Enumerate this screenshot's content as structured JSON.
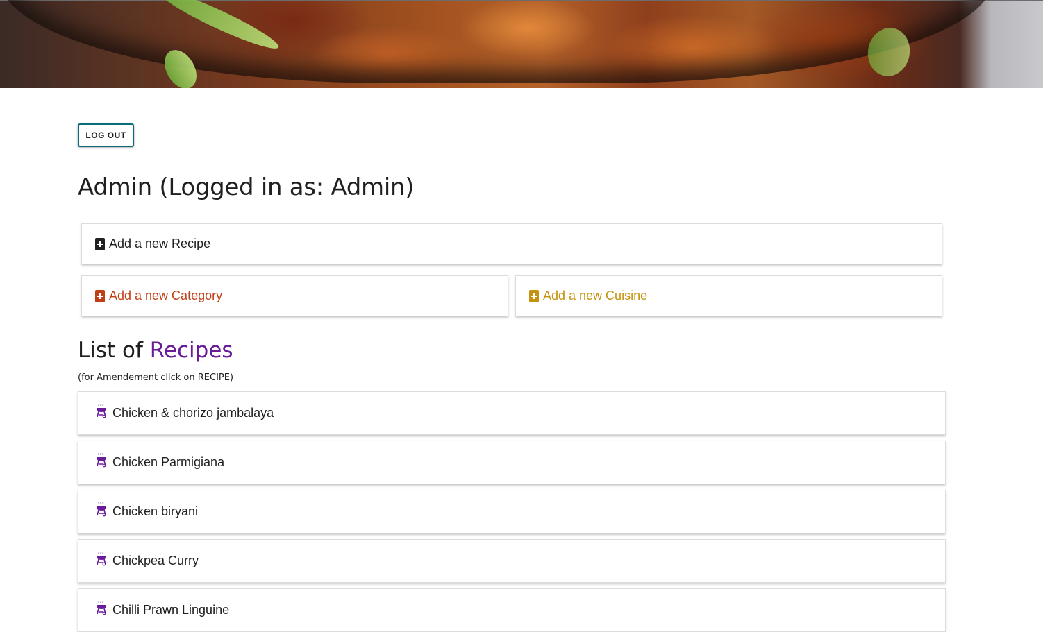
{
  "header": {
    "logout_label": "LOG OUT"
  },
  "page": {
    "title": "Admin (Logged in as: Admin)"
  },
  "actions": {
    "add_recipe": "Add a new Recipe",
    "add_category": "Add a new Category",
    "add_cuisine": "Add a new Cuisine"
  },
  "recipes_section": {
    "title_prefix": "List of",
    "title_accent": "Recipes",
    "hint": "(for Amendement click on RECIPE)",
    "items": [
      "Chicken & chorizo jambalaya",
      "Chicken Parmigiana",
      "Chicken biryani",
      "Chickpea Curry",
      "Chilli Prawn Linguine"
    ]
  },
  "colors": {
    "logout_border": "#0c6b78",
    "category": "#c13f16",
    "cuisine": "#c4920c",
    "accent_purple": "#6a1b9a"
  },
  "icons": {
    "recipe": "file-plus-icon",
    "category": "file-plus-icon",
    "cuisine": "file-plus-icon",
    "recipe_item": "grill-icon"
  }
}
